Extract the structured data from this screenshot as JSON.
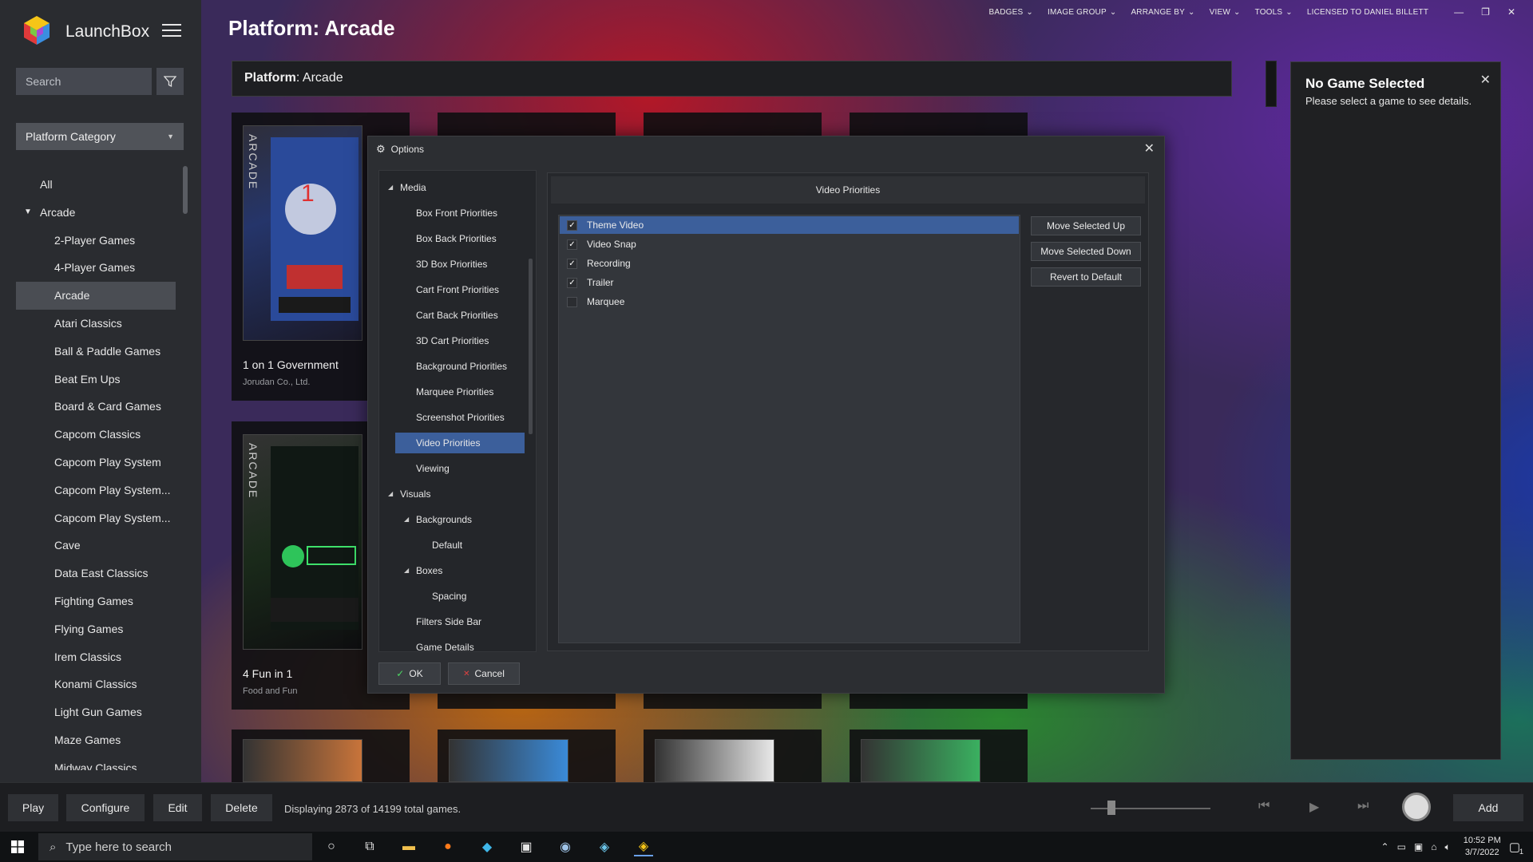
{
  "app": {
    "title": "LaunchBox"
  },
  "sidebar": {
    "search_placeholder": "Search",
    "category_dropdown": "Platform Category",
    "items": [
      {
        "label": "All",
        "level": 0
      },
      {
        "label": "Arcade",
        "level": 0,
        "expanded": true
      },
      {
        "label": "2-Player Games",
        "level": 1
      },
      {
        "label": "4-Player Games",
        "level": 1
      },
      {
        "label": "Arcade",
        "level": 1,
        "active": true
      },
      {
        "label": "Atari Classics",
        "level": 1
      },
      {
        "label": "Ball & Paddle Games",
        "level": 1
      },
      {
        "label": "Beat Em Ups",
        "level": 1
      },
      {
        "label": "Board & Card Games",
        "level": 1
      },
      {
        "label": "Capcom Classics",
        "level": 1
      },
      {
        "label": "Capcom Play System",
        "level": 1
      },
      {
        "label": "Capcom Play System...",
        "level": 1
      },
      {
        "label": "Capcom Play System...",
        "level": 1
      },
      {
        "label": "Cave",
        "level": 1
      },
      {
        "label": "Data East Classics",
        "level": 1
      },
      {
        "label": "Fighting Games",
        "level": 1
      },
      {
        "label": "Flying Games",
        "level": 1
      },
      {
        "label": "Irem Classics",
        "level": 1
      },
      {
        "label": "Konami Classics",
        "level": 1
      },
      {
        "label": "Light Gun Games",
        "level": 1
      },
      {
        "label": "Maze Games",
        "level": 1
      },
      {
        "label": "Midway Classics",
        "level": 1
      }
    ]
  },
  "header": {
    "page_title": "Platform: Arcade",
    "platform_label": "Platform",
    "platform_value": ": Arcade",
    "menu": [
      "BADGES",
      "IMAGE GROUP",
      "ARRANGE BY",
      "VIEW",
      "TOOLS"
    ],
    "license": "LICENSED TO DANIEL BILLETT"
  },
  "games": [
    {
      "name": "1 on 1 Government",
      "publisher": "Jorudan Co., Ltd.",
      "box_label": "ARCADE"
    },
    {
      "name": "4 Fun in 1",
      "publisher": "Food  and Fun",
      "box_label": "ARCADE"
    }
  ],
  "details": {
    "title": "No Game Selected",
    "subtitle": "Please select a game to see details."
  },
  "dialog": {
    "title": "Options",
    "panel_title": "Video Priorities",
    "tree": [
      {
        "label": "Media",
        "level": 0,
        "arrow": true
      },
      {
        "label": "Box Front Priorities",
        "level": 1
      },
      {
        "label": "Box Back Priorities",
        "level": 1
      },
      {
        "label": "3D Box Priorities",
        "level": 1
      },
      {
        "label": "Cart Front Priorities",
        "level": 1
      },
      {
        "label": "Cart Back Priorities",
        "level": 1
      },
      {
        "label": "3D Cart Priorities",
        "level": 1
      },
      {
        "label": "Background Priorities",
        "level": 1
      },
      {
        "label": "Marquee Priorities",
        "level": 1
      },
      {
        "label": "Screenshot Priorities",
        "level": 1
      },
      {
        "label": "Video Priorities",
        "level": 1,
        "selected": true
      },
      {
        "label": "Viewing",
        "level": 1
      },
      {
        "label": "Visuals",
        "level": 0,
        "arrow": true
      },
      {
        "label": "Backgrounds",
        "level": 1,
        "arrow": true
      },
      {
        "label": "Default",
        "level": 2
      },
      {
        "label": "Boxes",
        "level": 1,
        "arrow": true
      },
      {
        "label": "Spacing",
        "level": 2
      },
      {
        "label": "Filters Side Bar",
        "level": 1
      },
      {
        "label": "Game Details",
        "level": 1
      }
    ],
    "priorities": [
      {
        "label": "Theme Video",
        "checked": true,
        "selected": true
      },
      {
        "label": "Video Snap",
        "checked": true
      },
      {
        "label": "Recording",
        "checked": true
      },
      {
        "label": "Trailer",
        "checked": true
      },
      {
        "label": "Marquee",
        "checked": false
      }
    ],
    "buttons": {
      "move_up": "Move Selected Up",
      "move_down": "Move Selected Down",
      "revert": "Revert to Default",
      "ok": "OK",
      "cancel": "Cancel"
    }
  },
  "bottombar": {
    "play": "Play",
    "configure": "Configure",
    "edit": "Edit",
    "delete": "Delete",
    "status": "Displaying 2873 of 14199 total games.",
    "add": "Add"
  },
  "taskbar": {
    "search_placeholder": "Type here to search",
    "time": "10:52 PM",
    "date": "3/7/2022",
    "notification_count": "1"
  },
  "colors": {
    "selection": "#3c5f9b",
    "sidebar_bg": "#2a2c30",
    "dialog_bg": "#2c2e32"
  }
}
